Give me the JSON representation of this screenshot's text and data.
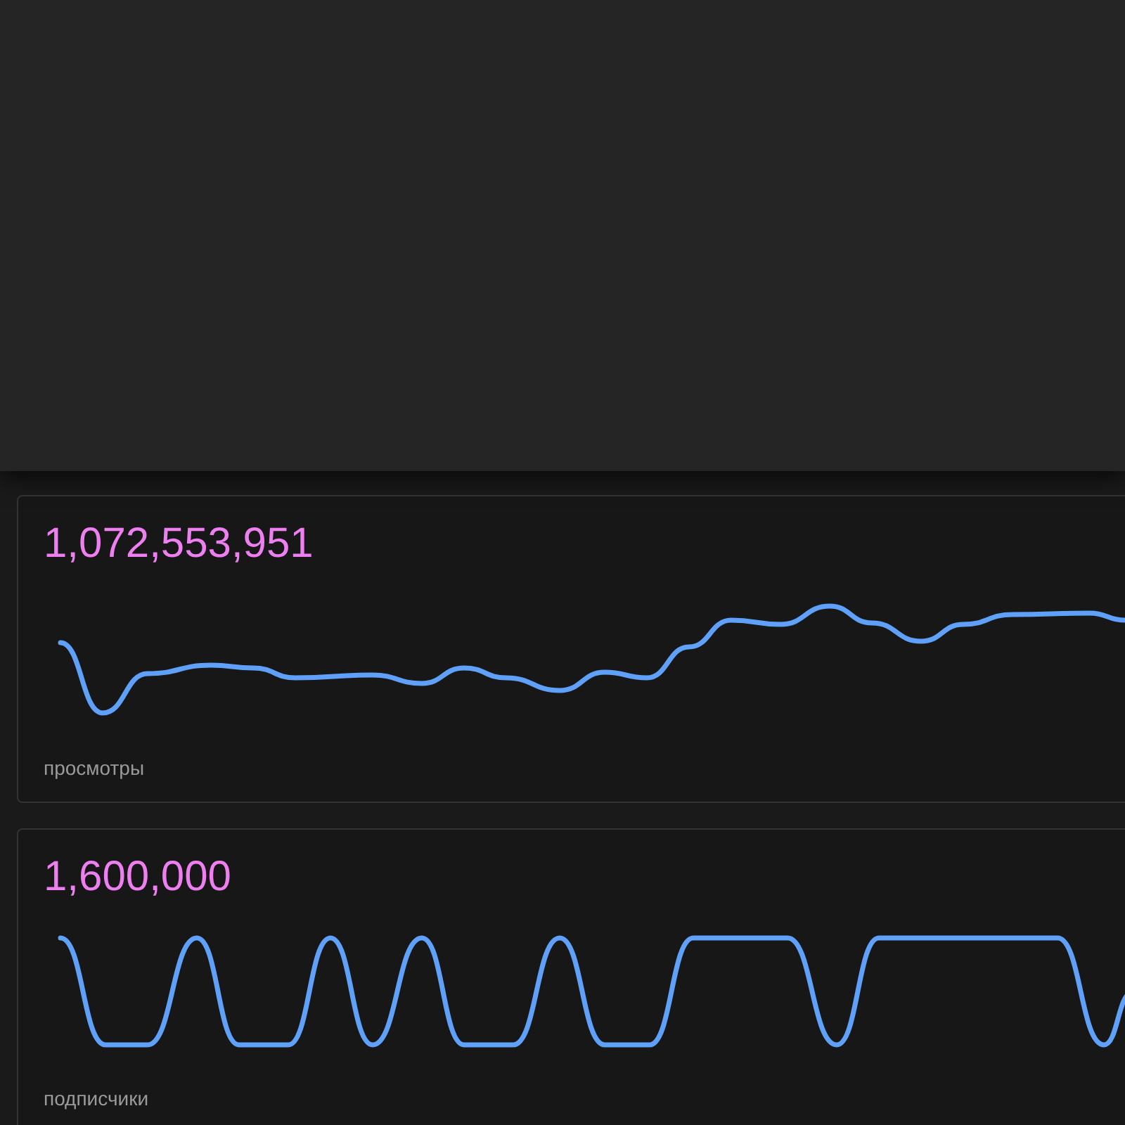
{
  "cards": [
    {
      "value": "1,072,553,951",
      "label": "просмотры"
    },
    {
      "value": "1,600,000",
      "label": "подписчики"
    }
  ]
}
